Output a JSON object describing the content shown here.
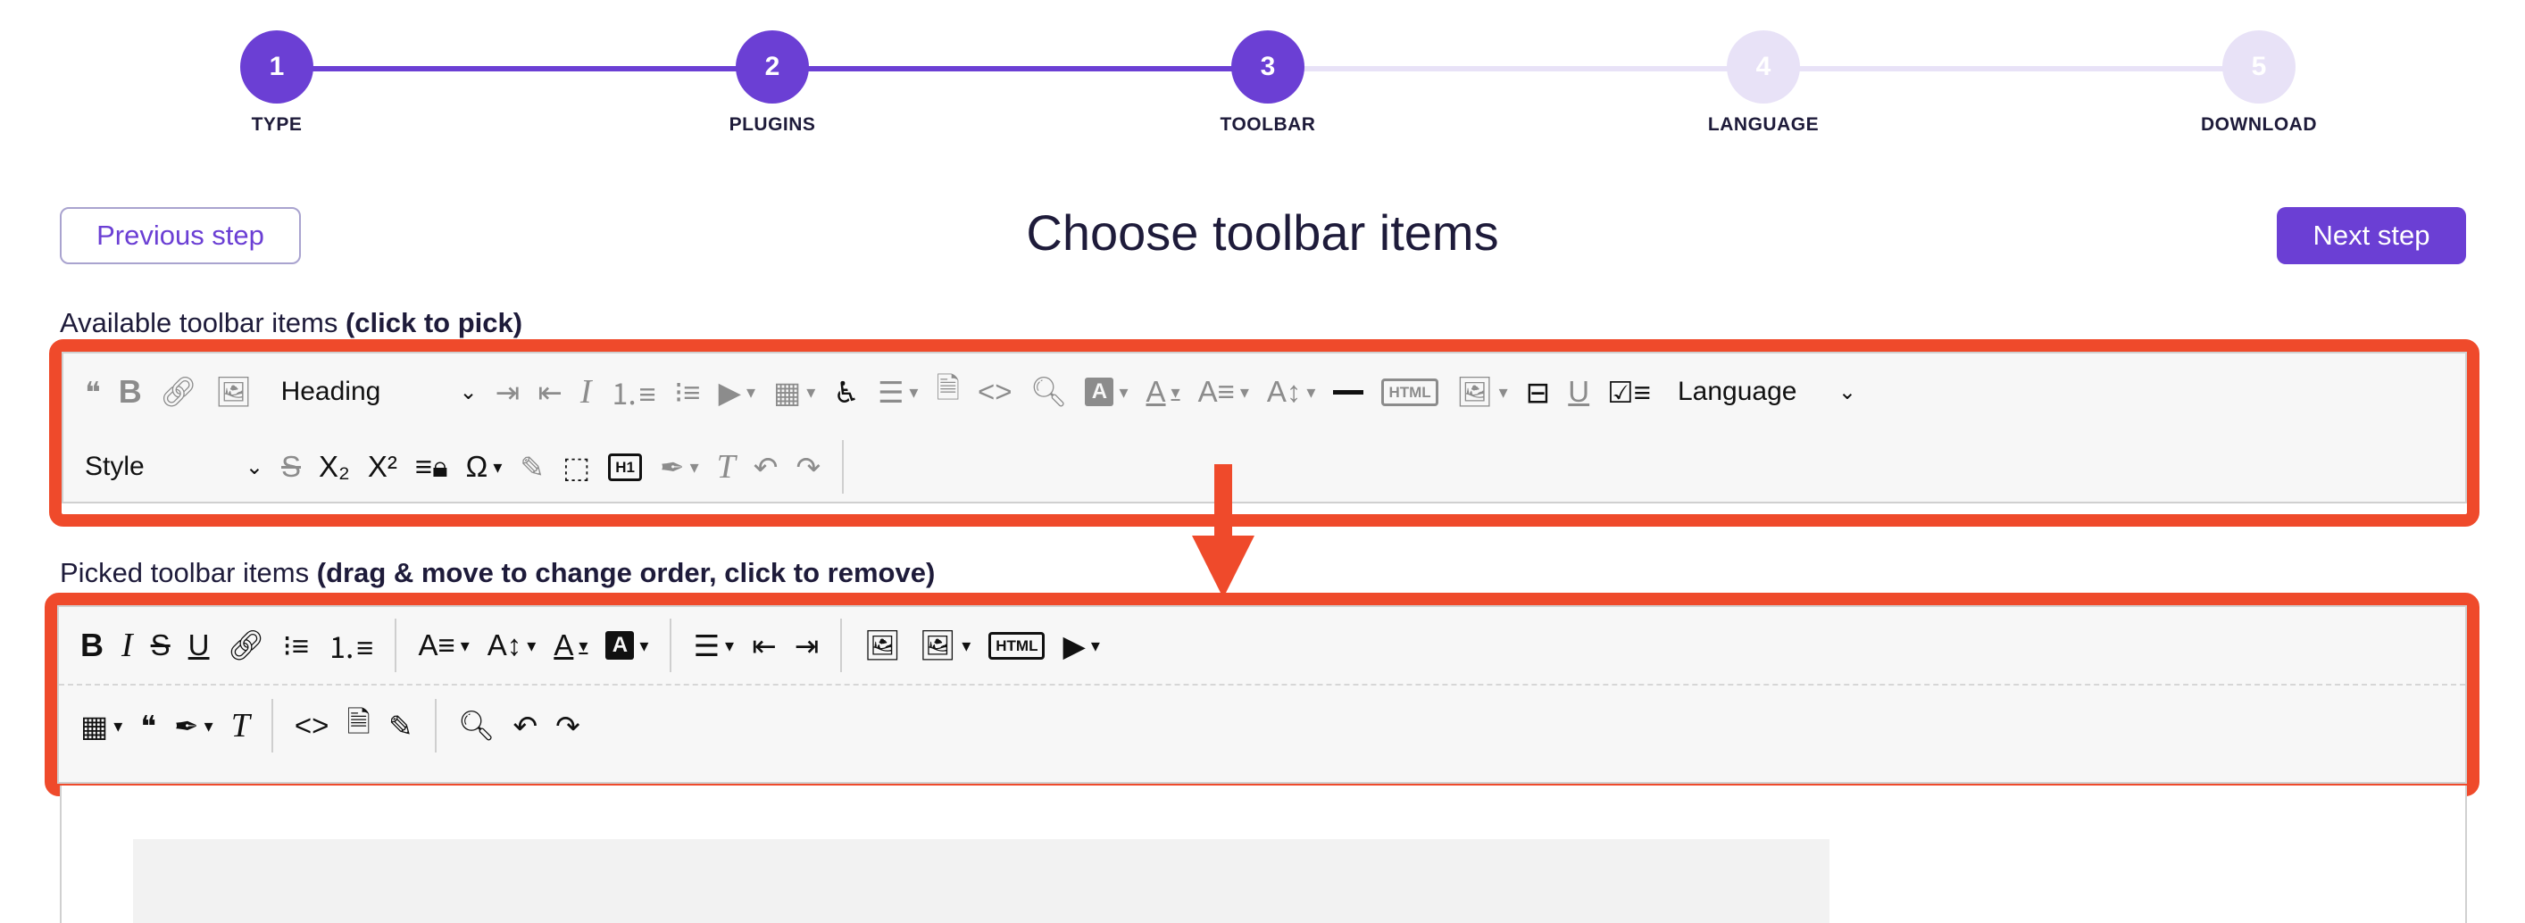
{
  "stepper": {
    "steps": [
      {
        "num": "1",
        "label": "TYPE"
      },
      {
        "num": "2",
        "label": "PLUGINS"
      },
      {
        "num": "3",
        "label": "TOOLBAR"
      },
      {
        "num": "4",
        "label": "LANGUAGE"
      },
      {
        "num": "5",
        "label": "DOWNLOAD"
      }
    ],
    "active_upto": 3
  },
  "header": {
    "prev_label": "Previous step",
    "title": "Choose toolbar items",
    "next_label": "Next step"
  },
  "available": {
    "label": "Available toolbar items",
    "hint": "(click to pick)",
    "heading_label": "Heading",
    "language_label": "Language",
    "style_label": "Style",
    "html_label": "HTML",
    "h1_label": "H1"
  },
  "picked": {
    "label": "Picked toolbar items",
    "hint": "(drag & move to change order, click to remove)",
    "html_label": "HTML"
  },
  "colors": {
    "accent": "#6b3fd4",
    "step_inactive": "#e8e2f7",
    "highlight": "#ef4a2b"
  }
}
